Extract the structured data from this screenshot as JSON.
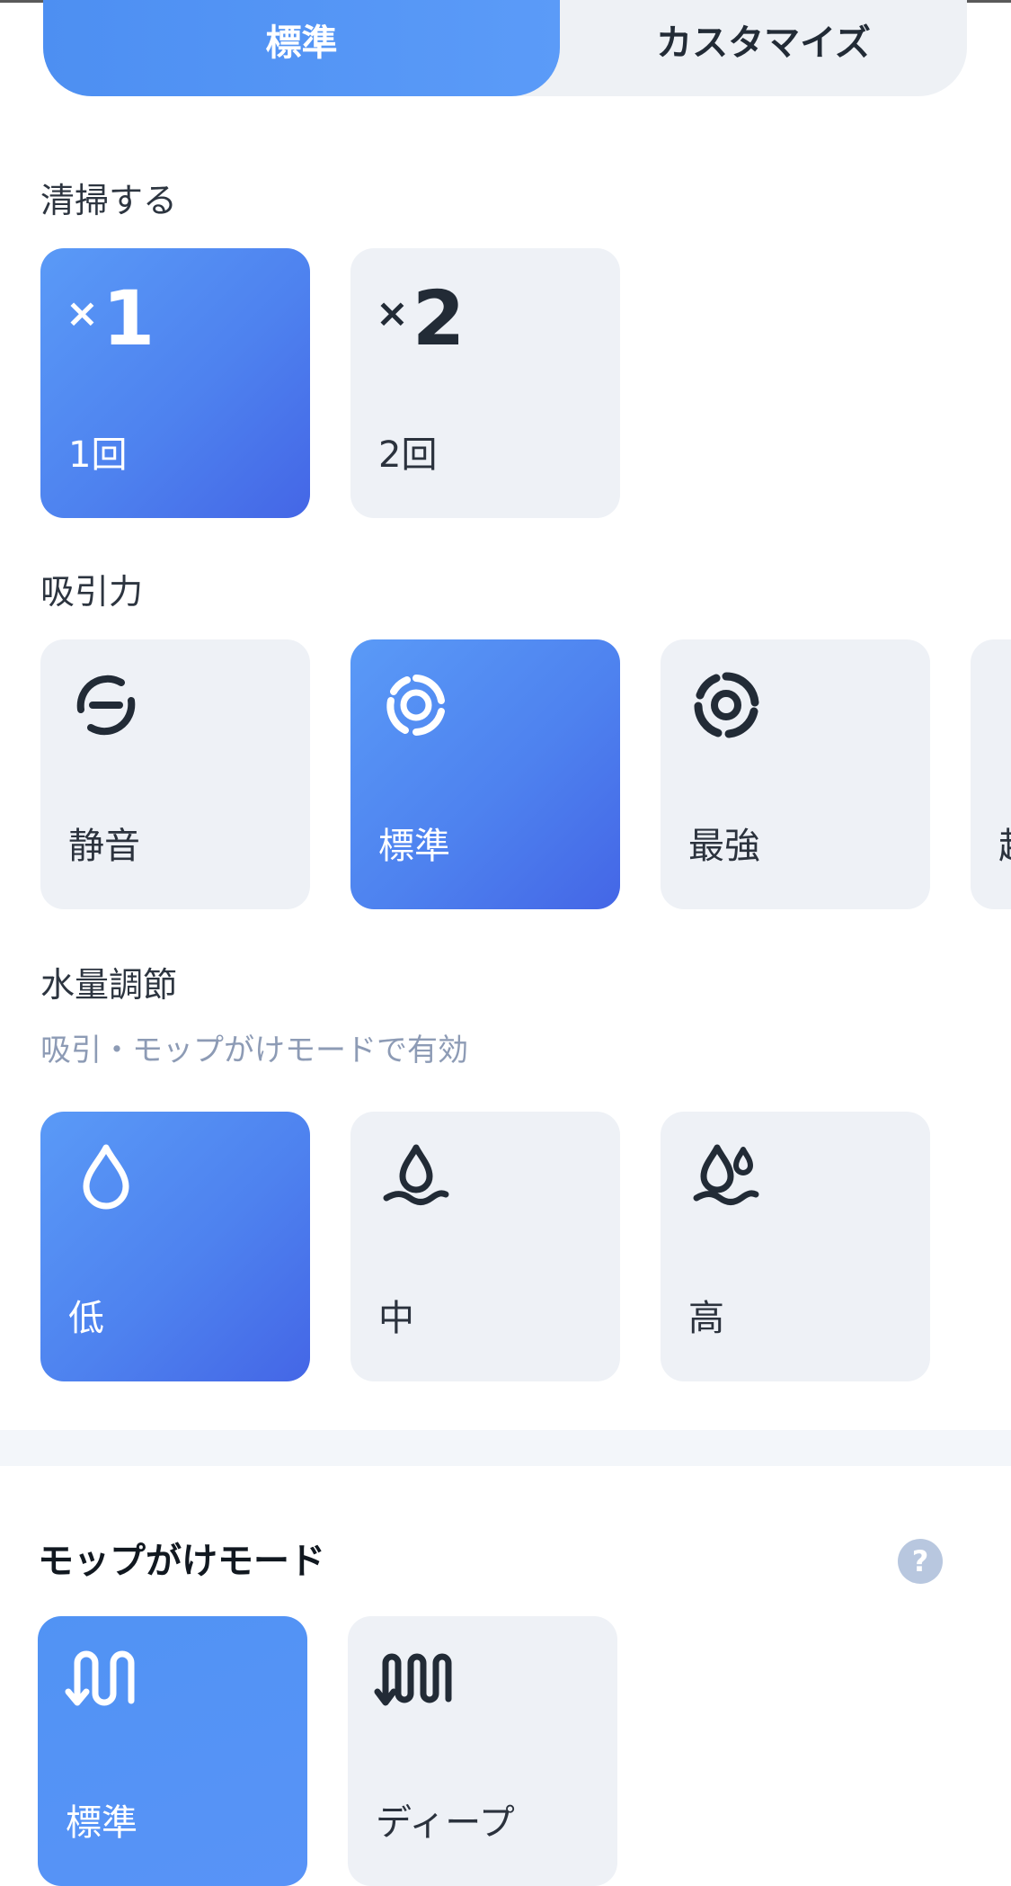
{
  "tabs": {
    "standard": "標準",
    "custom": "カスタマイズ"
  },
  "clean_times": {
    "title": "清掃する",
    "options": [
      {
        "mark": "1",
        "prefix": "×",
        "label": "1回",
        "selected": true
      },
      {
        "mark": "2",
        "prefix": "×",
        "label": "2回",
        "selected": false
      }
    ]
  },
  "suction": {
    "title": "吸引力",
    "options": [
      {
        "label": "静音",
        "icon": "quiet-fan-icon",
        "selected": false
      },
      {
        "label": "標準",
        "icon": "standard-fan-icon",
        "selected": true
      },
      {
        "label": "最強",
        "icon": "max-fan-icon",
        "selected": false
      },
      {
        "label": "超",
        "icon": "turbo-fan-icon",
        "selected": false
      }
    ]
  },
  "water": {
    "title": "水量調節",
    "subtitle": "吸引・モップがけモードで有効",
    "options": [
      {
        "label": "低",
        "icon": "water-drop-low-icon",
        "selected": true
      },
      {
        "label": "中",
        "icon": "water-drop-medium-icon",
        "selected": false
      },
      {
        "label": "高",
        "icon": "water-drop-high-icon",
        "selected": false
      }
    ]
  },
  "mop_mode": {
    "title": "モップがけモード",
    "help": "?",
    "options": [
      {
        "label": "標準",
        "icon": "mop-standard-path-icon",
        "selected": true
      },
      {
        "label": "ディープ",
        "icon": "mop-deep-path-icon",
        "selected": false
      }
    ]
  },
  "colors": {
    "accent": "#5193f4",
    "accent_dark": "#4466e6",
    "card_bg": "#eef1f6",
    "hint": "#8d9bb5"
  }
}
